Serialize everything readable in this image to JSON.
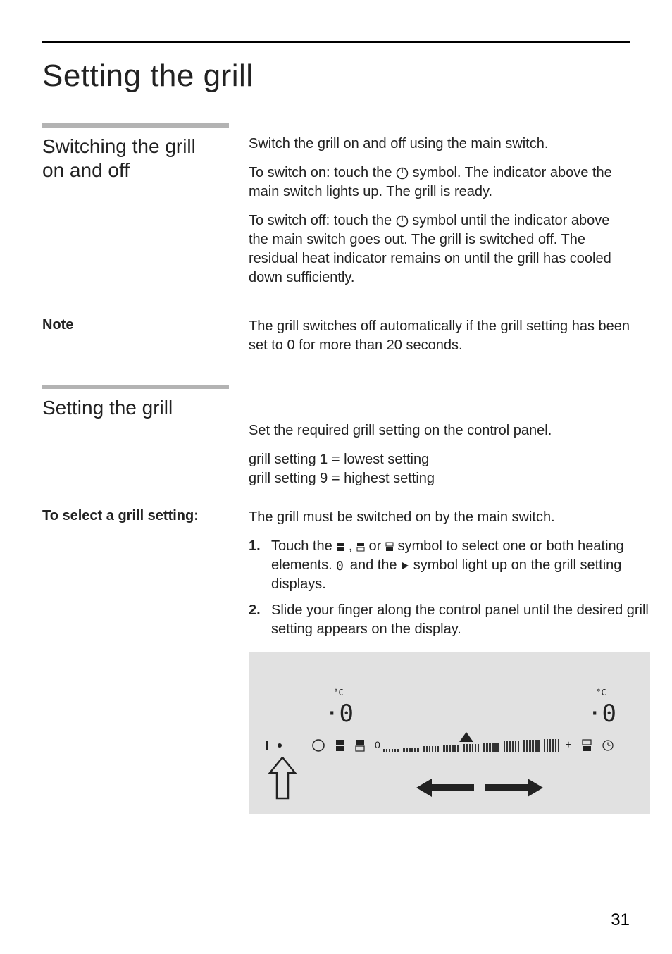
{
  "page": {
    "title": "Setting the grill",
    "number": "31"
  },
  "sec1": {
    "heading_l1": "Switching the grill",
    "heading_l2": "on and off",
    "p1": "Switch the grill on and off using the main switch.",
    "p2a": "To switch on: touch the ",
    "p2b": " symbol. The indicator above the main switch lights up. The grill is ready.",
    "p3a": "To switch off: touch the ",
    "p3b": " symbol until the indicator above the main switch goes out. The grill is switched off. The residual heat indicator remains on until the grill has cooled down sufficiently.",
    "note_label": "Note",
    "note_body": "The grill switches off automatically if the grill setting has been set to 0 for more than 20 seconds."
  },
  "sec2": {
    "heading": "Setting the grill",
    "p1": "Set the required grill setting on the control panel.",
    "p2": "grill setting 1 = lowest setting",
    "p3": "grill setting 9 = highest setting"
  },
  "sec3": {
    "heading": "To select a grill setting:",
    "intro": "The grill must be switched on by the main switch.",
    "step1_num": "1.",
    "step1a": "Touch the ",
    "step1b": " , ",
    "step1c": " or ",
    "step1d": " symbol to select one or both heating elements. ",
    "step1e": " and the ",
    "step1f": " symbol light up on the grill setting displays.",
    "step2_num": "2.",
    "step2": "Slide your finger along the control panel until the desired grill setting appears on the display."
  },
  "panel": {
    "unit": "°C",
    "seg": "0",
    "zero": "0",
    "plus": "+"
  },
  "icons": {
    "power": "power-icon",
    "both": "zone-both-icon",
    "top": "zone-top-icon",
    "bottom": "zone-bottom-icon",
    "zero_seg": "digit-zero-icon",
    "play": "play-icon"
  }
}
